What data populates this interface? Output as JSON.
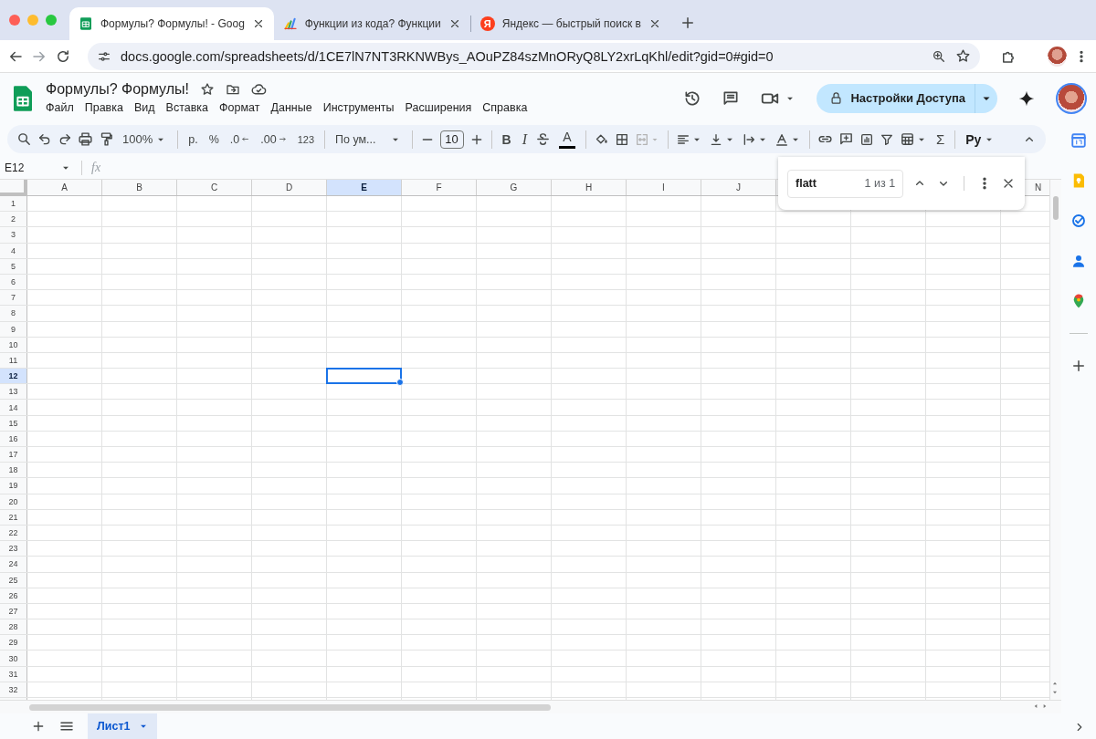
{
  "browser": {
    "tabs": [
      {
        "title": "Формулы? Формулы! - Goog",
        "selected": true,
        "kind": "sheets"
      },
      {
        "title": "Функции из кода? Функции",
        "selected": false,
        "kind": "chart"
      },
      {
        "title": "Яндекс — быстрый поиск в",
        "selected": false,
        "kind": "letter",
        "icon_text": "Я"
      }
    ],
    "url": "docs.google.com/spreadsheets/d/1CE7lN7NT3RKNWBys_AOuPZ84szMnORyQ8LY2xrLqKhl/edit?gid=0#gid=0"
  },
  "document": {
    "title": "Формулы? Формулы!",
    "menu": [
      "Файл",
      "Правка",
      "Вид",
      "Вставка",
      "Формат",
      "Данные",
      "Инструменты",
      "Расширения",
      "Справка"
    ]
  },
  "share_button": "Настройки Доступа",
  "toolbar": {
    "zoom": "100%",
    "currency": "р.",
    "percent": "%",
    "decimal_decrease": ".0",
    "decimal_increase": ".00",
    "number_format": "123",
    "font": "По ум...",
    "font_size": "10",
    "bold": "B",
    "italic": "I",
    "text_color": "A",
    "functions": "Σ",
    "input_tools": "Ру"
  },
  "name_box": "E12",
  "formula_label": "fx",
  "columns": [
    {
      "label": "A",
      "selected": false
    },
    {
      "label": "B",
      "selected": false
    },
    {
      "label": "C",
      "selected": false
    },
    {
      "label": "D",
      "selected": false
    },
    {
      "label": "E",
      "selected": true
    },
    {
      "label": "F",
      "selected": false
    },
    {
      "label": "G",
      "selected": false
    },
    {
      "label": "H",
      "selected": false
    },
    {
      "label": "I",
      "selected": false
    },
    {
      "label": "J",
      "selected": false
    },
    {
      "label": "N",
      "selected": false
    }
  ],
  "rows": [
    {
      "label": "1",
      "selected": false
    },
    {
      "label": "2",
      "selected": false
    },
    {
      "label": "3",
      "selected": false
    },
    {
      "label": "4",
      "selected": false
    },
    {
      "label": "5",
      "selected": false
    },
    {
      "label": "6",
      "selected": false
    },
    {
      "label": "7",
      "selected": false
    },
    {
      "label": "8",
      "selected": false
    },
    {
      "label": "9",
      "selected": false
    },
    {
      "label": "10",
      "selected": false
    },
    {
      "label": "11",
      "selected": false
    },
    {
      "label": "12",
      "selected": true
    },
    {
      "label": "13",
      "selected": false
    },
    {
      "label": "14",
      "selected": false
    },
    {
      "label": "15",
      "selected": false
    },
    {
      "label": "16",
      "selected": false
    },
    {
      "label": "17",
      "selected": false
    },
    {
      "label": "18",
      "selected": false
    },
    {
      "label": "19",
      "selected": false
    },
    {
      "label": "20",
      "selected": false
    },
    {
      "label": "21",
      "selected": false
    },
    {
      "label": "22",
      "selected": false
    },
    {
      "label": "23",
      "selected": false
    },
    {
      "label": "24",
      "selected": false
    },
    {
      "label": "25",
      "selected": false
    },
    {
      "label": "26",
      "selected": false
    },
    {
      "label": "27",
      "selected": false
    },
    {
      "label": "28",
      "selected": false
    },
    {
      "label": "29",
      "selected": false
    },
    {
      "label": "30",
      "selected": false
    },
    {
      "label": "31",
      "selected": false
    },
    {
      "label": "32",
      "selected": false
    }
  ],
  "find": {
    "value": "flatt",
    "count": "1 из 1"
  },
  "sheets": [
    {
      "name": "Лист1",
      "selected": true
    }
  ]
}
